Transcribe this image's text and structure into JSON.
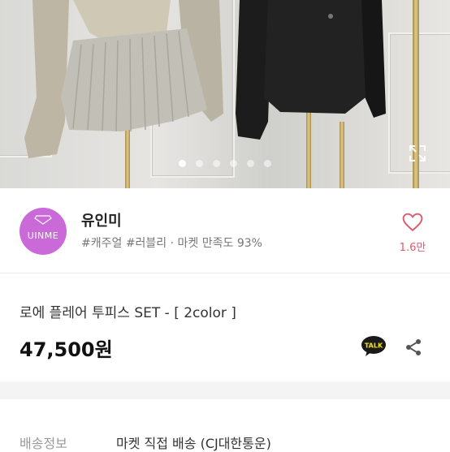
{
  "gallery": {
    "slides": 6,
    "active_index": 0,
    "expand_icon": "expand-icon"
  },
  "shop": {
    "avatar_text": "UINME",
    "name": "유인미",
    "meta": "#캐주얼 #러블리 · 마켓 만족도 93%",
    "like_count": "1.6만",
    "brand_color": "#c96ad8"
  },
  "product": {
    "title": "로에 플레어 투피스 SET - [ 2color ]",
    "price": "47,500원",
    "talk_label": "TALK"
  },
  "shipping": {
    "label": "배송정보",
    "value": "마켓 직접 배송 (CJ대한통운)"
  }
}
